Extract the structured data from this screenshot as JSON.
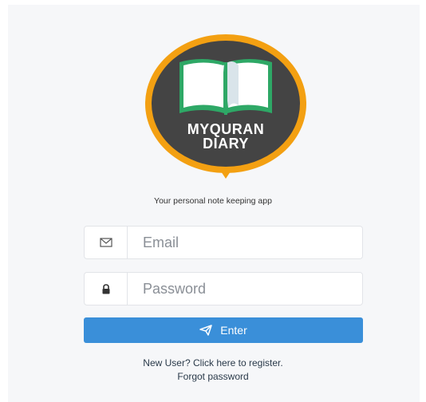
{
  "logo": {
    "line1": "MYQURAN",
    "line2": "DIARY",
    "icon": "open-book-icon",
    "colors": {
      "ring": "#f3a012",
      "badge": "#444444",
      "book": "#2ea866"
    }
  },
  "tagline": "Your personal note keeping app",
  "form": {
    "email_placeholder": "Email",
    "password_placeholder": "Password",
    "email_icon": "envelope-icon",
    "password_icon": "lock-icon",
    "submit_label": "Enter",
    "submit_icon": "paper-plane-icon"
  },
  "links": {
    "register": "New User? Click here to register.",
    "forgot": "Forgot password"
  },
  "colors": {
    "accent": "#3a8fd9",
    "background": "#f6f7f9"
  }
}
